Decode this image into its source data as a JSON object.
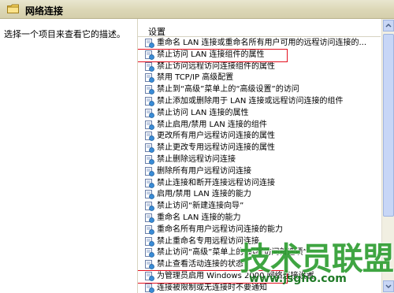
{
  "window": {
    "title": "网络连接",
    "left_description": "选择一个项目来查看它的描述。"
  },
  "list": {
    "header": "设置",
    "items": [
      "重命名 LAN 连接或重命名所有用户可用的远程访问连接的...",
      "禁止访问 LAN 连接组件的属性",
      "禁止访问远程访问连接组件的属性",
      "禁用 TCP/IP 高级配置",
      "禁止到“高级”菜单上的“高级设置”的访问",
      "禁止添加或删除用于 LAN 连接或远程访问连接的组件",
      "禁止访问 LAN 连接的属性",
      "禁止启用/禁用 LAN 连接的组件",
      "更改所有用户远程访问连接的属性",
      "禁止更改专用远程访问连接的属性",
      "禁止删除远程访问连接",
      "删除所有用户远程访问连接",
      "禁止连接和断开连接远程访问连接",
      "启用/禁用 LAN 连接的能力",
      "禁止访问“新建连接向导”",
      "重命名 LAN 连接的能力",
      "重命名所有用户远程访问连接的能力",
      "禁止重命名专用远程访问连接",
      "禁止访问“高级”菜单上的“远程访问首选项”",
      "禁止查看活动连接的状态",
      "为管理员启用 Windows 2000 网络连接设置",
      "连接被限制或无连接时不要通知"
    ],
    "highlighted": [
      1,
      20
    ]
  },
  "watermark": {
    "main": "技术员联盟",
    "url": "www.jsgho.com"
  },
  "colors": {
    "highlight_border": "#e4101f",
    "titlebar": "#dcd7b6",
    "watermark": "#2f9e33"
  }
}
